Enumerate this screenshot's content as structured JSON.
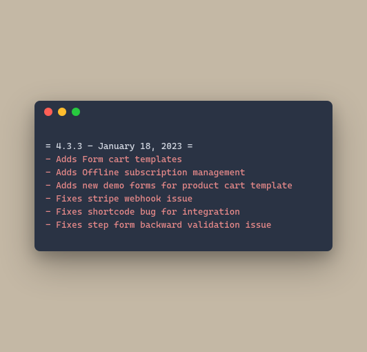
{
  "window": {
    "traffic_lights": [
      "close",
      "minimize",
      "zoom"
    ]
  },
  "changelog": {
    "heading": "= 4.3.3 – January 18, 2023 =",
    "entries": [
      "- Adds Form cart templates",
      "- Adds Offline subscription management",
      "- Adds new demo forms for product cart template",
      "- Fixes stripe webhook issue",
      "- Fixes shortcode bug for integration",
      "- Fixes step form backward validation issue"
    ]
  }
}
